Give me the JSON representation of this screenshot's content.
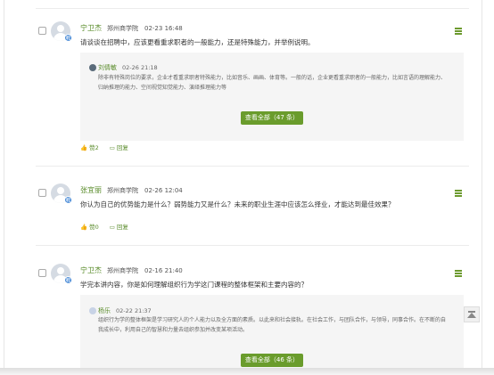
{
  "posts": [
    {
      "author": "宁卫杰",
      "school": "郑州商学院",
      "time": "02-23 16:48",
      "badge": "教",
      "question": "请谈谈在招聘中，应该更看重求职者的一般能力，还是特殊能力，并举例说明。",
      "reply": {
        "author": "刘倩敏",
        "time": "02-26 21:18",
        "text": "除非有特殊岗位的要求，企业才看重求职者特殊能力，比如音乐、画画、体育等。一般的话，企业更看重求职者的一般能力，比如言语的理解能力、归纳推理的能力、空间视觉知觉能力、演绎推理能力等"
      },
      "view_all": "查看全部（47 条）",
      "likes": "赞2",
      "reply_label": "回复"
    },
    {
      "author": "张宜丽",
      "school": "郑州商学院",
      "time": "02-26 12:04",
      "badge": "教",
      "question": "你认为自己的优势能力是什么？弱势能力又是什么？未来的职业生涯中应该怎么择业，才能达到最佳效果？",
      "likes": "赞0",
      "reply_label": "回复"
    },
    {
      "author": "宁卫杰",
      "school": "郑州商学院",
      "time": "02-16 21:40",
      "badge": "教",
      "question": "学完本讲内容，你是如何理解组织行为学这门课程的整体框架和主要内容的？",
      "reply": {
        "author": "杨乐",
        "time": "02-22 21:37",
        "text": "组织行为学的整体框架是学习研究人的个人能力以及全方面的素质。以此来和社会接轨。在社会工作，与团队合作，与领导，同事合作。在不断的自我成长中，利用自己的智慧和力量去组织参加并改变某项活动。"
      },
      "view_all": "查看全部（46 条）"
    }
  ],
  "colors": {
    "accent": "#6a9c2c",
    "name": "#5a8c2b",
    "reply_bg": "#f5f5f5"
  }
}
